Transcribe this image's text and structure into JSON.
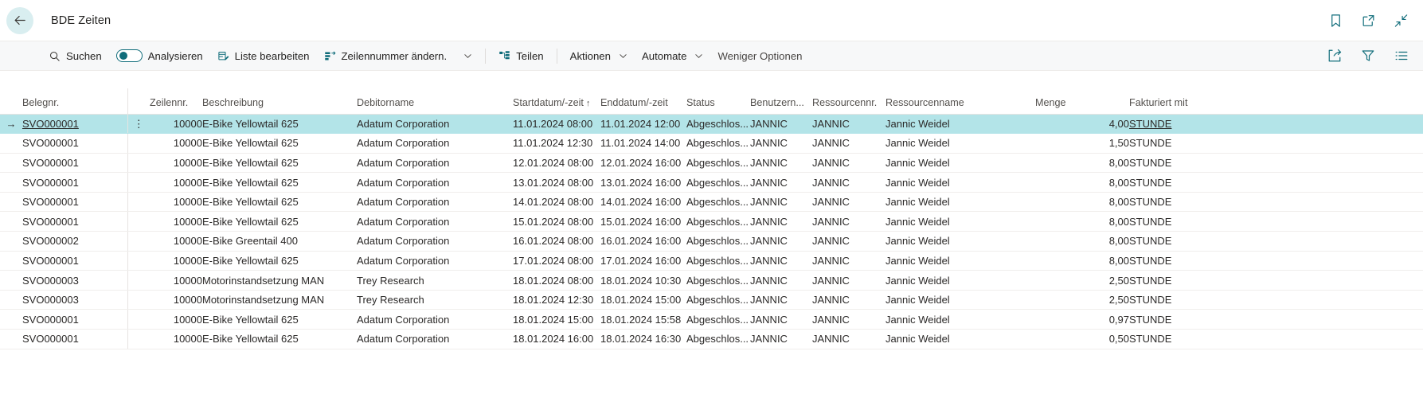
{
  "titlebar": {
    "back_label": "Back",
    "title": "BDE Zeiten",
    "icons": [
      {
        "name": "bookmark-icon",
        "label": "Bookmark"
      },
      {
        "name": "open-in-new-window-icon",
        "label": "Open in new window"
      },
      {
        "name": "collapse-icon",
        "label": "Collapse"
      }
    ]
  },
  "commandbar": {
    "search": "Suchen",
    "analyze": "Analysieren",
    "edit_list": "Liste bearbeiten",
    "change_line_number": "Zeilennummer ändern.",
    "more_caret": "⌄",
    "share": "Teilen",
    "actions": "Aktionen",
    "automate": "Automate",
    "fewer_options": "Weniger Optionen",
    "right_icons": [
      {
        "name": "share-export-icon",
        "label": "Senden an"
      },
      {
        "name": "filter-icon",
        "label": "Filter"
      },
      {
        "name": "list-options-icon",
        "label": "Listenoptionen"
      }
    ]
  },
  "table": {
    "columns": [
      {
        "key": "doc",
        "label": "Belegnr."
      },
      {
        "key": "line",
        "label": "Zeilennr."
      },
      {
        "key": "desc",
        "label": "Beschreibung"
      },
      {
        "key": "cust",
        "label": "Debitorname"
      },
      {
        "key": "start",
        "label": "Startdatum/-zeit",
        "sort": "↑"
      },
      {
        "key": "end",
        "label": "Enddatum/-zeit"
      },
      {
        "key": "status",
        "label": "Status"
      },
      {
        "key": "user",
        "label": "Benutzern..."
      },
      {
        "key": "resno",
        "label": "Ressourcennr."
      },
      {
        "key": "resname",
        "label": "Ressourcenname"
      },
      {
        "key": "qty",
        "label": "Menge"
      },
      {
        "key": "unit",
        "label": "Fakturiert mit"
      }
    ],
    "row_indicator": "→",
    "row_menu": "⋮",
    "rows": [
      {
        "selected": true,
        "doc": "SVO000001",
        "line": "10000",
        "desc": "E-Bike Yellowtail 625",
        "cust": "Adatum Corporation",
        "start": "11.01.2024 08:00",
        "end": "11.01.2024 12:00",
        "status": "Abgeschlos...",
        "user": "JANNIC",
        "resno": "JANNIC",
        "resname": "Jannic Weidel",
        "qty": "4,00",
        "unit": "STUNDE"
      },
      {
        "selected": false,
        "doc": "SVO000001",
        "line": "10000",
        "desc": "E-Bike Yellowtail 625",
        "cust": "Adatum Corporation",
        "start": "11.01.2024 12:30",
        "end": "11.01.2024 14:00",
        "status": "Abgeschlos...",
        "user": "JANNIC",
        "resno": "JANNIC",
        "resname": "Jannic Weidel",
        "qty": "1,50",
        "unit": "STUNDE"
      },
      {
        "selected": false,
        "doc": "SVO000001",
        "line": "10000",
        "desc": "E-Bike Yellowtail 625",
        "cust": "Adatum Corporation",
        "start": "12.01.2024 08:00",
        "end": "12.01.2024 16:00",
        "status": "Abgeschlos...",
        "user": "JANNIC",
        "resno": "JANNIC",
        "resname": "Jannic Weidel",
        "qty": "8,00",
        "unit": "STUNDE"
      },
      {
        "selected": false,
        "doc": "SVO000001",
        "line": "10000",
        "desc": "E-Bike Yellowtail 625",
        "cust": "Adatum Corporation",
        "start": "13.01.2024 08:00",
        "end": "13.01.2024 16:00",
        "status": "Abgeschlos...",
        "user": "JANNIC",
        "resno": "JANNIC",
        "resname": "Jannic Weidel",
        "qty": "8,00",
        "unit": "STUNDE"
      },
      {
        "selected": false,
        "doc": "SVO000001",
        "line": "10000",
        "desc": "E-Bike Yellowtail 625",
        "cust": "Adatum Corporation",
        "start": "14.01.2024 08:00",
        "end": "14.01.2024 16:00",
        "status": "Abgeschlos...",
        "user": "JANNIC",
        "resno": "JANNIC",
        "resname": "Jannic Weidel",
        "qty": "8,00",
        "unit": "STUNDE"
      },
      {
        "selected": false,
        "doc": "SVO000001",
        "line": "10000",
        "desc": "E-Bike Yellowtail 625",
        "cust": "Adatum Corporation",
        "start": "15.01.2024 08:00",
        "end": "15.01.2024 16:00",
        "status": "Abgeschlos...",
        "user": "JANNIC",
        "resno": "JANNIC",
        "resname": "Jannic Weidel",
        "qty": "8,00",
        "unit": "STUNDE"
      },
      {
        "selected": false,
        "doc": "SVO000002",
        "line": "10000",
        "desc": "E-Bike Greentail 400",
        "cust": "Adatum Corporation",
        "start": "16.01.2024 08:00",
        "end": "16.01.2024 16:00",
        "status": "Abgeschlos...",
        "user": "JANNIC",
        "resno": "JANNIC",
        "resname": "Jannic Weidel",
        "qty": "8,00",
        "unit": "STUNDE"
      },
      {
        "selected": false,
        "doc": "SVO000001",
        "line": "10000",
        "desc": "E-Bike Yellowtail 625",
        "cust": "Adatum Corporation",
        "start": "17.01.2024 08:00",
        "end": "17.01.2024 16:00",
        "status": "Abgeschlos...",
        "user": "JANNIC",
        "resno": "JANNIC",
        "resname": "Jannic Weidel",
        "qty": "8,00",
        "unit": "STUNDE"
      },
      {
        "selected": false,
        "doc": "SVO000003",
        "line": "10000",
        "desc": "Motorinstandsetzung MAN",
        "cust": "Trey Research",
        "start": "18.01.2024 08:00",
        "end": "18.01.2024 10:30",
        "status": "Abgeschlos...",
        "user": "JANNIC",
        "resno": "JANNIC",
        "resname": "Jannic Weidel",
        "qty": "2,50",
        "unit": "STUNDE"
      },
      {
        "selected": false,
        "doc": "SVO000003",
        "line": "10000",
        "desc": "Motorinstandsetzung MAN",
        "cust": "Trey Research",
        "start": "18.01.2024 12:30",
        "end": "18.01.2024 15:00",
        "status": "Abgeschlos...",
        "user": "JANNIC",
        "resno": "JANNIC",
        "resname": "Jannic Weidel",
        "qty": "2,50",
        "unit": "STUNDE"
      },
      {
        "selected": false,
        "doc": "SVO000001",
        "line": "10000",
        "desc": "E-Bike Yellowtail 625",
        "cust": "Adatum Corporation",
        "start": "18.01.2024 15:00",
        "end": "18.01.2024 15:58",
        "status": "Abgeschlos...",
        "user": "JANNIC",
        "resno": "JANNIC",
        "resname": "Jannic Weidel",
        "qty": "0,97",
        "unit": "STUNDE"
      },
      {
        "selected": false,
        "doc": "SVO000001",
        "line": "10000",
        "desc": "E-Bike Yellowtail 625",
        "cust": "Adatum Corporation",
        "start": "18.01.2024 16:00",
        "end": "18.01.2024 16:30",
        "status": "Abgeschlos...",
        "user": "JANNIC",
        "resno": "JANNIC",
        "resname": "Jannic Weidel",
        "qty": "0,50",
        "unit": "STUNDE"
      }
    ]
  },
  "colors": {
    "accent": "#0f6c7a",
    "selection": "#b3e4e8",
    "commandbar_bg": "#f7f8f9"
  }
}
